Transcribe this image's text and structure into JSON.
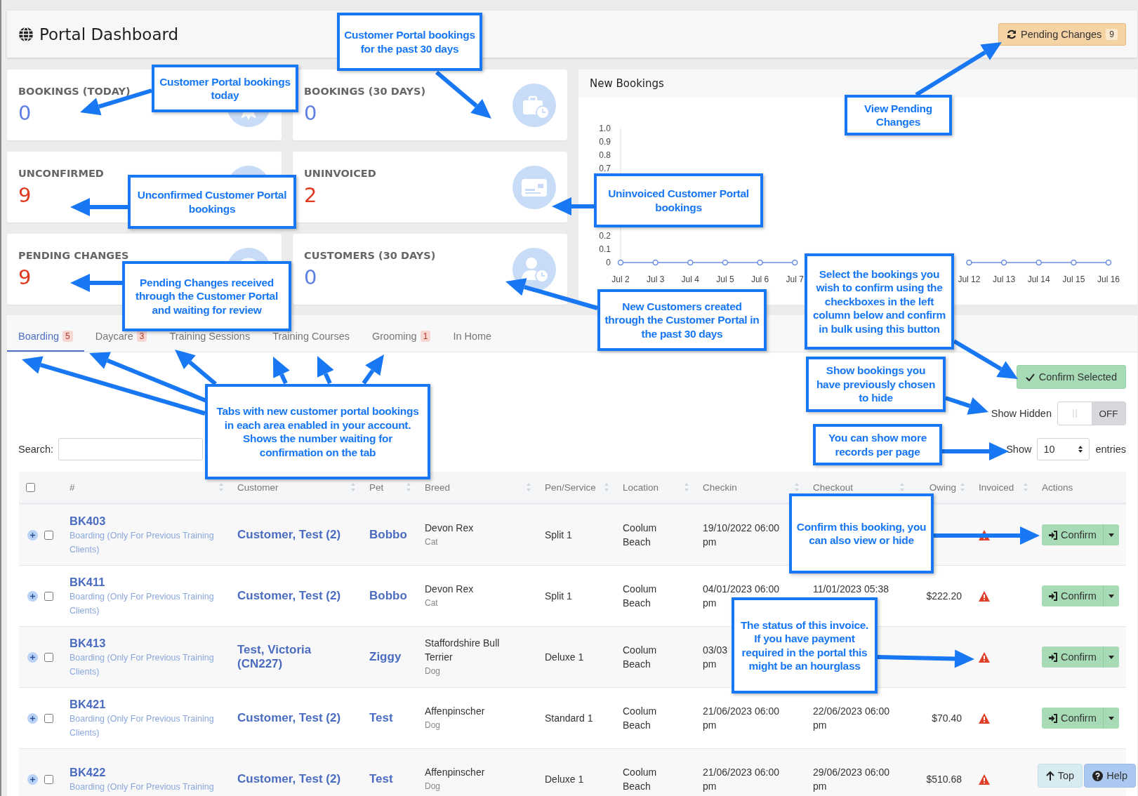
{
  "header": {
    "title": "Portal Dashboard",
    "pending_button": {
      "label": "Pending Changes",
      "count": "9"
    }
  },
  "stats": [
    {
      "label": "BOOKINGS (TODAY)",
      "value": "0",
      "color": "#5d7ee3"
    },
    {
      "label": "BOOKINGS (30 DAYS)",
      "value": "0",
      "color": "#5d7ee3"
    },
    {
      "label": "UNCONFIRMED",
      "value": "9",
      "color": "#e03a1e"
    },
    {
      "label": "UNINVOICED",
      "value": "2",
      "color": "#e03a1e"
    },
    {
      "label": "PENDING CHANGES",
      "value": "9",
      "color": "#e03a1e"
    },
    {
      "label": "CUSTOMERS (30 DAYS)",
      "value": "0",
      "color": "#5d7ee3"
    }
  ],
  "chart": {
    "chart_data": {
      "type": "line",
      "title": "New Bookings",
      "x": [
        "Jul 2",
        "Jul 3",
        "Jul 4",
        "Jul 5",
        "Jul 6",
        "Jul 7",
        null,
        null,
        null,
        null,
        "Jul 12",
        "Jul 13",
        "Jul 14",
        "Jul 15",
        "Jul 16"
      ],
      "series": [
        {
          "color": "#6b8ee0",
          "marker": true,
          "values": [
            0,
            0,
            0,
            0,
            0,
            0,
            null,
            null,
            null,
            null,
            0,
            0,
            0,
            0,
            0
          ]
        }
      ],
      "ylim": [
        0,
        1
      ],
      "yticks": [
        {
          "value": 0,
          "label": "0"
        },
        {
          "value": 0.1,
          "label": "0.1"
        },
        {
          "value": 0.2,
          "label": "0.2"
        },
        {
          "value": 0.7,
          "label": "0.7"
        },
        {
          "value": 0.8,
          "label": "0.8"
        },
        {
          "value": 0.9,
          "label": "0.9"
        },
        {
          "value": 1,
          "label": "1.0"
        }
      ]
    }
  },
  "tabs": [
    {
      "label": "Boarding",
      "count": "5",
      "selected": true
    },
    {
      "label": "Daycare",
      "count": "3",
      "selected": false
    },
    {
      "label": "Training Sessions",
      "selected": false
    },
    {
      "label": "Training Courses",
      "selected": false
    },
    {
      "label": "Grooming",
      "count": "1",
      "selected": false
    },
    {
      "label": "In Home",
      "selected": false
    }
  ],
  "toolbar": {
    "confirm_button": "Confirm Selected",
    "show_hidden": {
      "label": "Show Hidden",
      "on": false,
      "state_text": "OFF"
    },
    "page_size": {
      "prefix": "Show",
      "value": "10",
      "suffix": "entries"
    },
    "search": {
      "label": "Search:"
    }
  },
  "table": {
    "select_all_checked": false,
    "columns": [
      "#",
      "Customer",
      "Pet",
      "Breed",
      "Pen/Service",
      "Location",
      "Checkin",
      "Checkout",
      "Owing",
      "Invoiced",
      "Actions"
    ],
    "rows": [
      {
        "id": "BK403",
        "service": "Boarding (Only For Previous Training Clients)",
        "customer": "Customer, Test (2)",
        "pet": "Bobbo",
        "breed": "Devon Rex",
        "species": "Cat",
        "pen": "Split 1",
        "location": "Coolum Beach",
        "checkin": "19/10/2022 06:00 pm",
        "invoiced_warning": true,
        "checked": false,
        "action": "Confirm"
      },
      {
        "id": "BK411",
        "service": "Boarding (Only For Previous Training Clients)",
        "customer": "Customer, Test (2)",
        "pet": "Bobbo",
        "breed": "Devon Rex",
        "species": "Cat",
        "pen": "Split 1",
        "location": "Coolum Beach",
        "checkin": "04/01/2023 06:00 pm",
        "checkout": "11/01/2023 05:38",
        "owing": "$222.20",
        "invoiced_warning": true,
        "checked": false,
        "action": "Confirm"
      },
      {
        "id": "BK413",
        "service": "Boarding (Only For Previous Training Clients)",
        "customer": "Test, Victoria (CN227)",
        "pet": "Ziggy",
        "breed": "Staffordshire Bull Terrier",
        "species": "Dog",
        "pen": "Deluxe 1",
        "location": "Coolum Beach",
        "checkin": "03/03\npm",
        "invoiced_warning": true,
        "checked": false,
        "action": "Confirm"
      },
      {
        "id": "BK421",
        "service": "Boarding (Only For Previous Training Clients)",
        "customer": "Customer, Test (2)",
        "pet": "Test",
        "breed": "Affenpinscher",
        "species": "Dog",
        "pen": "Standard 1",
        "location": "Coolum Beach",
        "checkin": "21/06/2023 06:00 pm",
        "checkout": "22/06/2023 06:00 pm",
        "owing": "$70.40",
        "invoiced_warning": true,
        "checked": false,
        "action": "Confirm"
      },
      {
        "id": "BK422",
        "service": "Boarding (Only For Previous Training",
        "customer": "Customer, Test (2)",
        "pet": "Test",
        "breed": "Affenpinscher",
        "species": "Dog",
        "pen": "Deluxe 1",
        "location": "Coolum Beach",
        "checkin": "21/06/2023 06:00 pm",
        "checkout": "29/06/2023 06:00 pm",
        "owing": "$510.68",
        "invoiced_warning": true,
        "checked": false
      }
    ]
  },
  "floating_buttons": [
    {
      "label": "Top",
      "kind": "top"
    },
    {
      "label": "Help",
      "kind": "help"
    }
  ],
  "callouts": [
    {
      "text": "Customer Portal bookings for the past 30 days"
    },
    {
      "text": "Customer Portal bookings today"
    },
    {
      "text": "View Pending Changes"
    },
    {
      "text": "Unconfirmed Customer Portal bookings"
    },
    {
      "text": "Uninvoiced Customer Portal bookings"
    },
    {
      "text": "Pending Changes received through the Customer Portal and waiting for review"
    },
    {
      "text": "New Customers created through the Customer Portal in the past 30 days"
    },
    {
      "text": "Select the bookings you wish to confirm using the checkboxes in the left column below and confirm in bulk using this button"
    },
    {
      "text": "Show bookings you have previously chosen to hide"
    },
    {
      "text": "Tabs with new customer portal bookings in each area enabled in your account. Shows the number waiting for confirmation on the tab"
    },
    {
      "text": "You can show more records per page"
    },
    {
      "text": "Confirm this booking, you can also view or hide"
    },
    {
      "text": "The status of this invoice. If you have payment required in the portal this might be an hourglass"
    }
  ]
}
